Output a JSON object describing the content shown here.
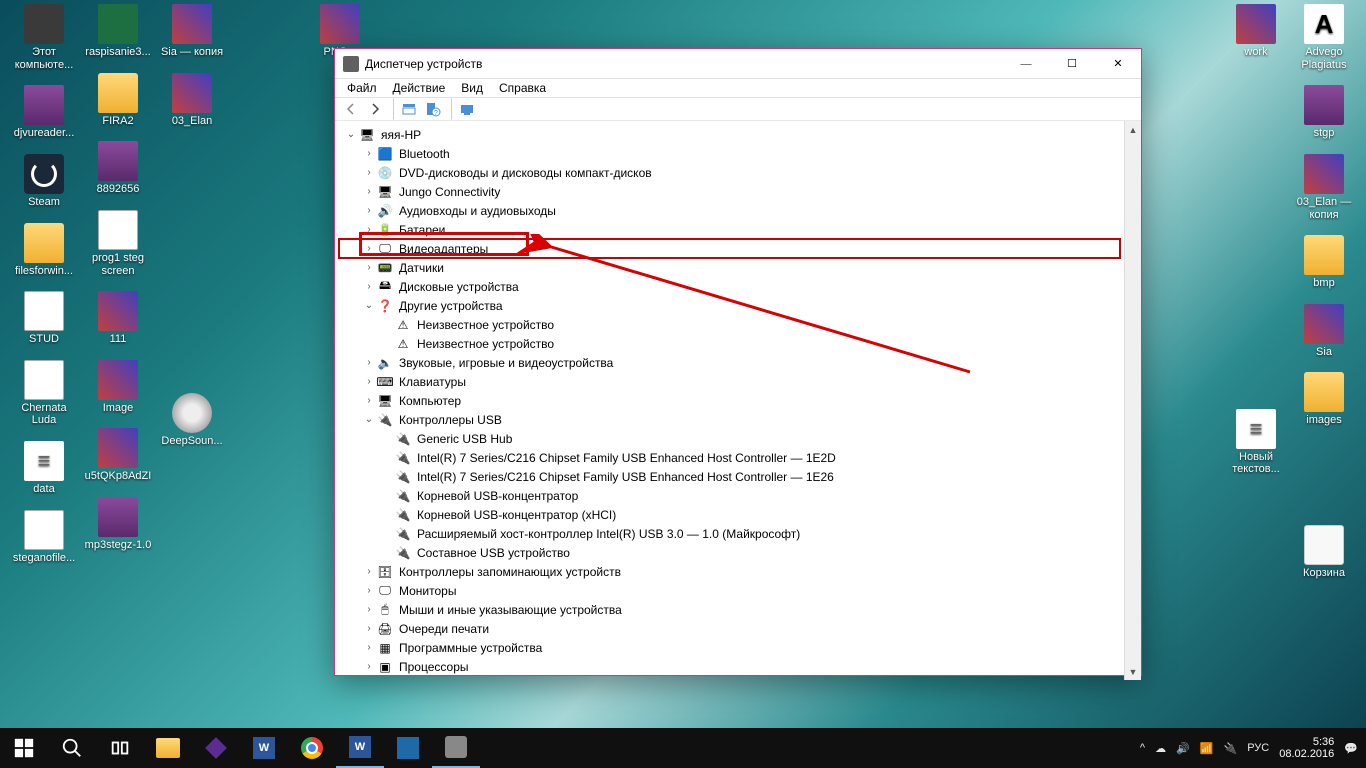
{
  "desktop": {
    "col1": [
      {
        "label": "Этот компьюте...",
        "kind": "pc"
      },
      {
        "label": "djvureader...",
        "kind": "rar"
      },
      {
        "label": "Steam",
        "kind": "steam"
      },
      {
        "label": "filesforwin...",
        "kind": "folder"
      },
      {
        "label": "STUD",
        "kind": "file"
      },
      {
        "label": "Chernata Luda",
        "kind": "file"
      },
      {
        "label": "data",
        "kind": "txt"
      },
      {
        "label": "steganofile...",
        "kind": "file"
      }
    ],
    "col2": [
      {
        "label": "raspisanie3...",
        "kind": "xls"
      },
      {
        "label": "FIRA2",
        "kind": "folder"
      },
      {
        "label": "8892656",
        "kind": "rar"
      },
      {
        "label": "prog1 steg screen",
        "kind": "file"
      },
      {
        "label": "111",
        "kind": "img"
      },
      {
        "label": "Image",
        "kind": "img"
      },
      {
        "label": "u5tQKp8AdZI",
        "kind": "img"
      },
      {
        "label": "mp3stegz-1.0",
        "kind": "rar"
      }
    ],
    "col3": [
      {
        "label": "Sia — копия",
        "kind": "img"
      },
      {
        "label": "03_Elan",
        "kind": "img"
      },
      {
        "label": "",
        "kind": ""
      },
      {
        "label": "",
        "kind": ""
      },
      {
        "label": "",
        "kind": ""
      },
      {
        "label": "DeepSoun...",
        "kind": "disk"
      }
    ],
    "col4": [
      {
        "label": "PNG...",
        "kind": "img"
      }
    ],
    "col5": [
      {
        "label": "work",
        "kind": "img"
      },
      {
        "label": "",
        "kind": ""
      },
      {
        "label": "",
        "kind": ""
      },
      {
        "label": "",
        "kind": ""
      },
      {
        "label": "",
        "kind": ""
      },
      {
        "label": "Новый текстов...",
        "kind": "txt"
      }
    ],
    "col6": [
      {
        "label": "Advego Plagiatus",
        "kind": "advego"
      },
      {
        "label": "stgp",
        "kind": "rar"
      },
      {
        "label": "03_Elan — копия",
        "kind": "img"
      },
      {
        "label": "bmp",
        "kind": "folder"
      },
      {
        "label": "Sia",
        "kind": "img"
      },
      {
        "label": "images",
        "kind": "folder"
      },
      {
        "label": "",
        "kind": ""
      },
      {
        "label": "Корзина",
        "kind": "bin"
      }
    ]
  },
  "window": {
    "title": "Диспетчер устройств",
    "menu": [
      "Файл",
      "Действие",
      "Вид",
      "Справка"
    ],
    "root": "яяя-HP",
    "items": [
      {
        "lvl": 1,
        "exp": "›",
        "icon": "🟦",
        "label": "Bluetooth"
      },
      {
        "lvl": 1,
        "exp": "›",
        "icon": "💿",
        "label": "DVD-дисководы и дисководы компакт-дисков"
      },
      {
        "lvl": 1,
        "exp": "›",
        "icon": "🖥",
        "label": "Jungo Connectivity"
      },
      {
        "lvl": 1,
        "exp": "›",
        "icon": "🔊",
        "label": "Аудиовходы и аудиовыходы"
      },
      {
        "lvl": 1,
        "exp": "›",
        "icon": "🔋",
        "label": "Батареи"
      },
      {
        "lvl": 1,
        "exp": "›",
        "icon": "🖵",
        "label": "Видеоадаптеры",
        "hl": true
      },
      {
        "lvl": 1,
        "exp": "›",
        "icon": "📟",
        "label": "Датчики"
      },
      {
        "lvl": 1,
        "exp": "›",
        "icon": "🖴",
        "label": "Дисковые устройства"
      },
      {
        "lvl": 1,
        "exp": "⌄",
        "icon": "❓",
        "label": "Другие устройства"
      },
      {
        "lvl": 2,
        "exp": " ",
        "icon": "⚠",
        "label": "Неизвестное устройство"
      },
      {
        "lvl": 2,
        "exp": " ",
        "icon": "⚠",
        "label": "Неизвестное устройство"
      },
      {
        "lvl": 1,
        "exp": "›",
        "icon": "🔈",
        "label": "Звуковые, игровые и видеоустройства"
      },
      {
        "lvl": 1,
        "exp": "›",
        "icon": "⌨",
        "label": "Клавиатуры"
      },
      {
        "lvl": 1,
        "exp": "›",
        "icon": "🖥",
        "label": "Компьютер"
      },
      {
        "lvl": 1,
        "exp": "⌄",
        "icon": "🔌",
        "label": "Контроллеры USB"
      },
      {
        "lvl": 2,
        "exp": " ",
        "icon": "🔌",
        "label": "Generic USB Hub"
      },
      {
        "lvl": 2,
        "exp": " ",
        "icon": "🔌",
        "label": "Intel(R) 7 Series/C216 Chipset Family USB Enhanced Host Controller — 1E2D"
      },
      {
        "lvl": 2,
        "exp": " ",
        "icon": "🔌",
        "label": "Intel(R) 7 Series/C216 Chipset Family USB Enhanced Host Controller — 1E26"
      },
      {
        "lvl": 2,
        "exp": " ",
        "icon": "🔌",
        "label": "Корневой USB-концентратор"
      },
      {
        "lvl": 2,
        "exp": " ",
        "icon": "🔌",
        "label": "Корневой USB-концентратор (xHCI)"
      },
      {
        "lvl": 2,
        "exp": " ",
        "icon": "🔌",
        "label": "Расширяемый хост-контроллер Intel(R) USB 3.0 — 1.0 (Майкрософт)"
      },
      {
        "lvl": 2,
        "exp": " ",
        "icon": "🔌",
        "label": "Составное USB устройство"
      },
      {
        "lvl": 1,
        "exp": "›",
        "icon": "🗄",
        "label": "Контроллеры запоминающих устройств"
      },
      {
        "lvl": 1,
        "exp": "›",
        "icon": "🖵",
        "label": "Мониторы"
      },
      {
        "lvl": 1,
        "exp": "›",
        "icon": "🖱",
        "label": "Мыши и иные указывающие устройства"
      },
      {
        "lvl": 1,
        "exp": "›",
        "icon": "🖨",
        "label": "Очереди печати"
      },
      {
        "lvl": 1,
        "exp": "›",
        "icon": "▦",
        "label": "Программные устройства"
      },
      {
        "lvl": 1,
        "exp": "›",
        "icon": "▣",
        "label": "Процессоры"
      }
    ]
  },
  "tray": {
    "lang": "РУС",
    "time": "5:36",
    "date": "08.02.2016"
  }
}
